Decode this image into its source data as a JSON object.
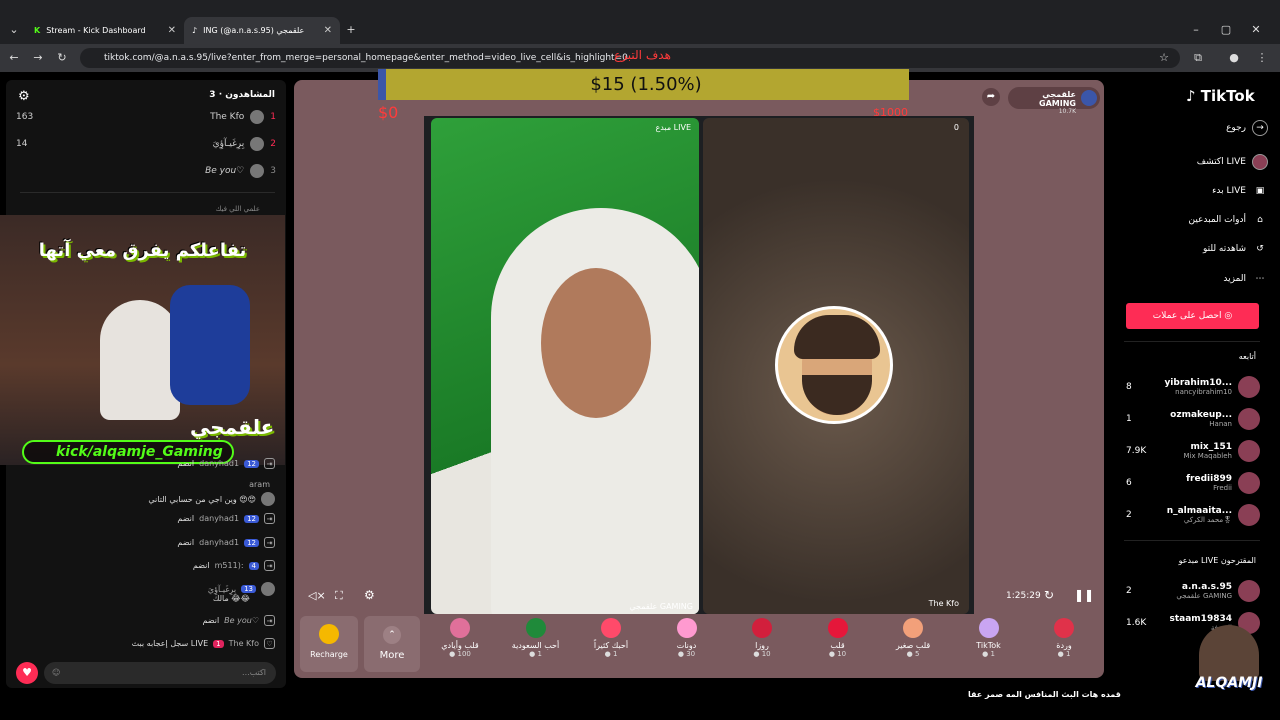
{
  "browser": {
    "tabs": [
      {
        "label": "Stream - Kick Dashboard",
        "active": false
      },
      {
        "label": "ING (@a.n.a.s.95) علقمجي",
        "active": true
      }
    ],
    "url": "tiktok.com/@a.n.a.s.95/live?enter_from_merge=personal_homepage&enter_method=video_live_cell&is_highlight=0"
  },
  "goal": {
    "title": "هدف التبرع",
    "amount_text": "$15 (1.50%)",
    "progress_fraction": 0.015,
    "min": "$0",
    "max": "$1000"
  },
  "left_panel": {
    "viewers_title": "المشاهدون · 3",
    "top_viewers": [
      {
        "rank": "1",
        "name": "The Kfo",
        "score": "163"
      },
      {
        "rank": "2",
        "name": "بِرِغَيـآؤِيَ",
        "score": "14"
      },
      {
        "rank": "3",
        "name": "Be you♡",
        "score": ""
      }
    ],
    "chat_header": "علمي اللي فيك",
    "chat": [
      {
        "user": "danyhad1",
        "level": "12",
        "text": "انضم"
      },
      {
        "user": "aram",
        "level": "",
        "text": "وين اجي من حسابي التاني 😍😍"
      },
      {
        "user": "danyhad1",
        "level": "12",
        "text": "انضم"
      },
      {
        "user": "danyhad1",
        "level": "12",
        "text": "انضم"
      },
      {
        "user": "m511):",
        "level": "4",
        "text": "انضم"
      },
      {
        "user": "بِرِغَيـآؤِيَ",
        "level": "13",
        "text": "مالك 😂😂"
      },
      {
        "user": "Be you♡",
        "level": "",
        "text": "انضم"
      },
      {
        "user": "The Kfo",
        "level": "1",
        "text": "سجل إعجابه ببث LIVE"
      }
    ],
    "overlay_banner": "تفاعلكم يفرق معي آتها",
    "overlay_name": "علقمجي",
    "kick_handle": "kick/alqamje_Gaming",
    "input_placeholder": "...اكتب"
  },
  "stream": {
    "host_name": "علقمجي GAMING",
    "host_followers": "10.7K",
    "left_label": "مبدع LIVE",
    "left_bottom": "علقمجي GAMING",
    "right_count": "0",
    "right_name": "The Kfo",
    "timer": "1:25:29"
  },
  "gifts": {
    "recharge": "Recharge",
    "more": "More",
    "items": [
      {
        "name": "قلب وأيادي",
        "price": "100",
        "color": "#e0709a"
      },
      {
        "name": "أحب السعودية",
        "price": "1",
        "color": "#1f8a3a"
      },
      {
        "name": "أحبك كثيراً",
        "price": "1",
        "color": "#ff4a6a"
      },
      {
        "name": "دونات",
        "price": "30",
        "color": "#ff9ad0"
      },
      {
        "name": "روزا",
        "price": "10",
        "color": "#d21f3c"
      },
      {
        "name": "قلب",
        "price": "10",
        "color": "#e5173a"
      },
      {
        "name": "قلب صغير",
        "price": "5",
        "color": "#f2a07a"
      },
      {
        "name": "TikTok",
        "price": "1",
        "color": "#c9a5f2"
      },
      {
        "name": "وردة",
        "price": "1",
        "color": "#e0324a"
      }
    ]
  },
  "sidebar": {
    "brand": "TikTok",
    "back": "رجوع",
    "nav": [
      {
        "label": "اكتشف LIVE",
        "icon": "live-avatar-icon"
      },
      {
        "label": "بدء LIVE",
        "icon": "camera-icon"
      },
      {
        "label": "أدوات المبدعين",
        "icon": "home-icon"
      },
      {
        "label": "شاهدته للتو",
        "icon": "history-icon"
      },
      {
        "label": "المزيد",
        "icon": "more-icon"
      }
    ],
    "coins_button": "احصل على عملات",
    "following_title": "أتابعه",
    "following": [
      {
        "name": "yibrahim10...",
        "sub": "nancyibrahim10",
        "count": "8"
      },
      {
        "name": "ozmakeup...",
        "sub": "Hanan",
        "count": "1"
      },
      {
        "name": "mix_151",
        "sub": "Mix Maqableh",
        "count": "7.9K"
      },
      {
        "name": "fredii899",
        "sub": "Fredii",
        "count": "6"
      },
      {
        "name": "n_almaaita...",
        "sub": "محمد الكركي🎖",
        "count": "2"
      }
    ],
    "suggested_title": "مبدعو LIVE المقترحون",
    "suggested": [
      {
        "name": "a.n.a.s.95",
        "sub": "علقمجي GAMING",
        "count": "2"
      },
      {
        "name": "staam19834",
        "sub": "الصرفة",
        "count": "1.6K"
      }
    ]
  },
  "caption": "قمده هات البث المنافس  المه صمر عقا",
  "watermark": "ALQAMJI"
}
